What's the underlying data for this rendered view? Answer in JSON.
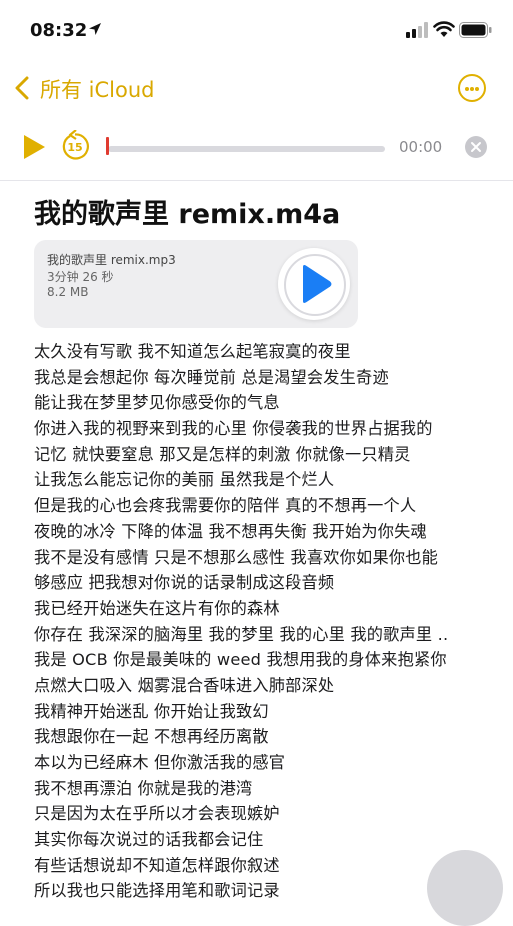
{
  "status": {
    "time": "08:32"
  },
  "nav": {
    "back_label": "所有 iCloud"
  },
  "player": {
    "elapsed": "00:00",
    "progress": 0
  },
  "note": {
    "title": "我的歌声里 remix.m4a",
    "attachment": {
      "name": "我的歌声里 remix.mp3",
      "duration": "3分钟 26 秒",
      "size": "8.2 MB"
    },
    "lines": [
      "太久没有写歌 我不知道怎么起笔寂寞的夜里",
      "我总是会想起你 每次睡觉前 总是渴望会发生奇迹",
      "能让我在梦里梦见你感受你的气息",
      "你进入我的视野来到我的心里 你侵袭我的世界占据我的",
      "记忆 就快要窒息 那又是怎样的刺激 你就像一只精灵",
      "让我怎么能忘记你的美丽 虽然我是个烂人",
      "但是我的心也会疼我需要你的陪伴 真的不想再一个人",
      "夜晚的冰冷 下降的体温 我不想再失衡 我开始为你失魂",
      "我不是没有感情 只是不想那么感性 我喜欢你如果你也能",
      "够感应  把我想对你说的话录制成这段音频",
      "我已经开始迷失在这片有你的森林",
      "你存在 我深深的脑海里 我的梦里 我的心里 我的歌声里 ..",
      "我是 OCB 你是最美味的 weed 我想用我的身体来抱紧你",
      "点燃大口吸入 烟雾混合香味进入肺部深处",
      "我精神开始迷乱 你开始让我致幻",
      "我想跟你在一起 不想再经历离散",
      "本以为已经麻木 但你激活我的感官",
      "我不想再漂泊 你就是我的港湾",
      "只是因为太在乎所以才会表现嫉妒",
      "其实你每次说过的话我都会记住",
      "有些话想说却不知道怎样跟你叙述",
      "所以我也只能选择用笔和歌词记录"
    ]
  },
  "colors": {
    "accent": "#e0b000",
    "playhead": "#e03b30",
    "attachment_play": "#1a7ef5"
  },
  "icons": [
    "location-arrow-icon",
    "signal-icon",
    "wifi-icon",
    "battery-icon",
    "chevron-left-icon",
    "more-icon",
    "play-icon",
    "skip-back-15-icon",
    "close-icon"
  ]
}
